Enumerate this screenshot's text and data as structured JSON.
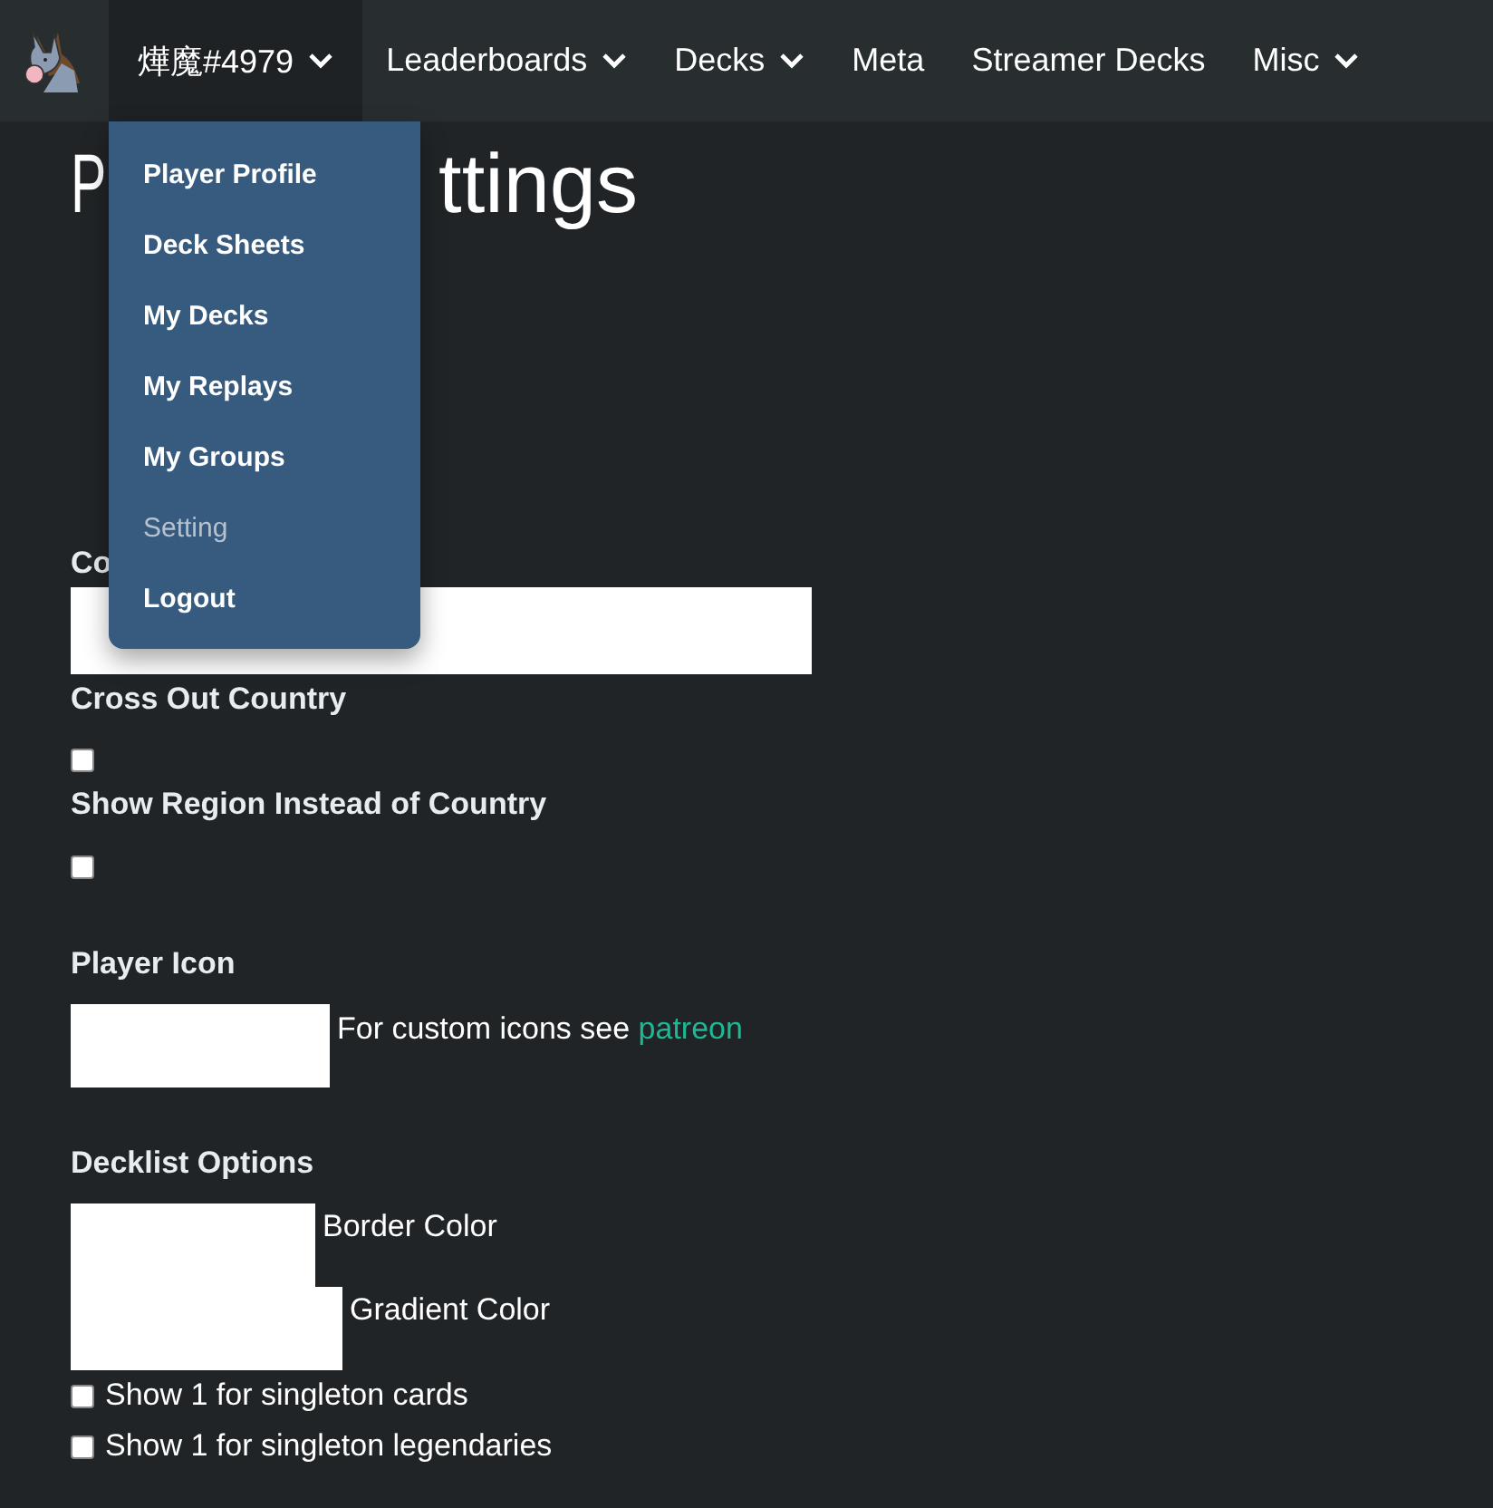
{
  "navbar": {
    "items": [
      {
        "label": "燁魔#4979",
        "dropdown": true,
        "selected": true
      },
      {
        "label": "Leaderboards",
        "dropdown": true,
        "selected": false
      },
      {
        "label": "Decks",
        "dropdown": true,
        "selected": false
      },
      {
        "label": "Meta",
        "dropdown": false,
        "selected": false
      },
      {
        "label": "Streamer Decks",
        "dropdown": false,
        "selected": false
      },
      {
        "label": "Misc",
        "dropdown": true,
        "selected": false
      }
    ]
  },
  "user_menu": {
    "items": [
      {
        "label": "Player Profile",
        "selected": false
      },
      {
        "label": "Deck Sheets",
        "selected": false
      },
      {
        "label": "My Decks",
        "selected": false
      },
      {
        "label": "My Replays",
        "selected": false
      },
      {
        "label": "My Groups",
        "selected": false
      },
      {
        "label": "Setting",
        "selected": true
      },
      {
        "label": "Logout",
        "selected": false
      }
    ]
  },
  "page": {
    "title_start": "P",
    "title_end": "ttings",
    "country": {
      "label": "Co"
    },
    "cross_out_country": {
      "label": "Cross Out Country",
      "checked": false
    },
    "show_region": {
      "label": "Show Region Instead of Country",
      "checked": false
    },
    "player_icon": {
      "label": "Player Icon",
      "note": "For custom icons see ",
      "link": "patreon"
    },
    "decklist_options": {
      "label": "Decklist Options",
      "colors": [
        {
          "label": "Border Color"
        },
        {
          "label": "Gradient Color"
        }
      ],
      "checkboxes": [
        {
          "label": "Show 1 for singleton cards",
          "checked": false
        },
        {
          "label": "Show 1 for singleton legendaries",
          "checked": false
        }
      ]
    }
  }
}
